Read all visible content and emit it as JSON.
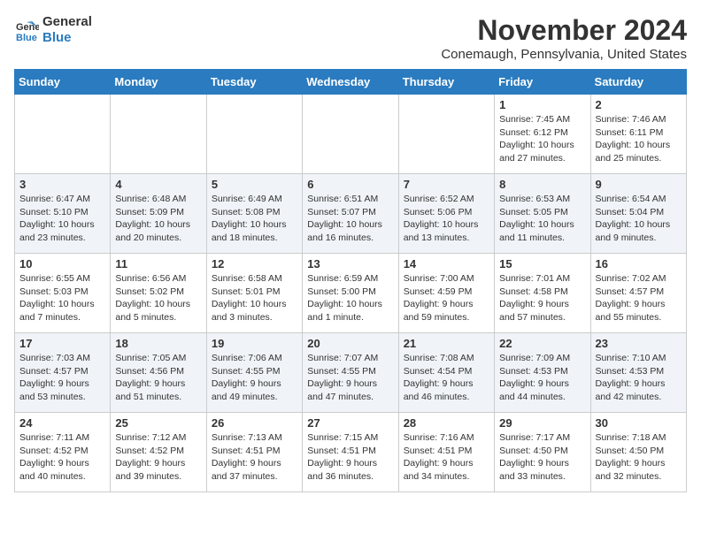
{
  "logo": {
    "text_general": "General",
    "text_blue": "Blue"
  },
  "title": "November 2024",
  "subtitle": "Conemaugh, Pennsylvania, United States",
  "days_of_week": [
    "Sunday",
    "Monday",
    "Tuesday",
    "Wednesday",
    "Thursday",
    "Friday",
    "Saturday"
  ],
  "weeks": [
    [
      {
        "day": "",
        "info": ""
      },
      {
        "day": "",
        "info": ""
      },
      {
        "day": "",
        "info": ""
      },
      {
        "day": "",
        "info": ""
      },
      {
        "day": "",
        "info": ""
      },
      {
        "day": "1",
        "info": "Sunrise: 7:45 AM\nSunset: 6:12 PM\nDaylight: 10 hours and 27 minutes."
      },
      {
        "day": "2",
        "info": "Sunrise: 7:46 AM\nSunset: 6:11 PM\nDaylight: 10 hours and 25 minutes."
      }
    ],
    [
      {
        "day": "3",
        "info": "Sunrise: 6:47 AM\nSunset: 5:10 PM\nDaylight: 10 hours and 23 minutes."
      },
      {
        "day": "4",
        "info": "Sunrise: 6:48 AM\nSunset: 5:09 PM\nDaylight: 10 hours and 20 minutes."
      },
      {
        "day": "5",
        "info": "Sunrise: 6:49 AM\nSunset: 5:08 PM\nDaylight: 10 hours and 18 minutes."
      },
      {
        "day": "6",
        "info": "Sunrise: 6:51 AM\nSunset: 5:07 PM\nDaylight: 10 hours and 16 minutes."
      },
      {
        "day": "7",
        "info": "Sunrise: 6:52 AM\nSunset: 5:06 PM\nDaylight: 10 hours and 13 minutes."
      },
      {
        "day": "8",
        "info": "Sunrise: 6:53 AM\nSunset: 5:05 PM\nDaylight: 10 hours and 11 minutes."
      },
      {
        "day": "9",
        "info": "Sunrise: 6:54 AM\nSunset: 5:04 PM\nDaylight: 10 hours and 9 minutes."
      }
    ],
    [
      {
        "day": "10",
        "info": "Sunrise: 6:55 AM\nSunset: 5:03 PM\nDaylight: 10 hours and 7 minutes."
      },
      {
        "day": "11",
        "info": "Sunrise: 6:56 AM\nSunset: 5:02 PM\nDaylight: 10 hours and 5 minutes."
      },
      {
        "day": "12",
        "info": "Sunrise: 6:58 AM\nSunset: 5:01 PM\nDaylight: 10 hours and 3 minutes."
      },
      {
        "day": "13",
        "info": "Sunrise: 6:59 AM\nSunset: 5:00 PM\nDaylight: 10 hours and 1 minute."
      },
      {
        "day": "14",
        "info": "Sunrise: 7:00 AM\nSunset: 4:59 PM\nDaylight: 9 hours and 59 minutes."
      },
      {
        "day": "15",
        "info": "Sunrise: 7:01 AM\nSunset: 4:58 PM\nDaylight: 9 hours and 57 minutes."
      },
      {
        "day": "16",
        "info": "Sunrise: 7:02 AM\nSunset: 4:57 PM\nDaylight: 9 hours and 55 minutes."
      }
    ],
    [
      {
        "day": "17",
        "info": "Sunrise: 7:03 AM\nSunset: 4:57 PM\nDaylight: 9 hours and 53 minutes."
      },
      {
        "day": "18",
        "info": "Sunrise: 7:05 AM\nSunset: 4:56 PM\nDaylight: 9 hours and 51 minutes."
      },
      {
        "day": "19",
        "info": "Sunrise: 7:06 AM\nSunset: 4:55 PM\nDaylight: 9 hours and 49 minutes."
      },
      {
        "day": "20",
        "info": "Sunrise: 7:07 AM\nSunset: 4:55 PM\nDaylight: 9 hours and 47 minutes."
      },
      {
        "day": "21",
        "info": "Sunrise: 7:08 AM\nSunset: 4:54 PM\nDaylight: 9 hours and 46 minutes."
      },
      {
        "day": "22",
        "info": "Sunrise: 7:09 AM\nSunset: 4:53 PM\nDaylight: 9 hours and 44 minutes."
      },
      {
        "day": "23",
        "info": "Sunrise: 7:10 AM\nSunset: 4:53 PM\nDaylight: 9 hours and 42 minutes."
      }
    ],
    [
      {
        "day": "24",
        "info": "Sunrise: 7:11 AM\nSunset: 4:52 PM\nDaylight: 9 hours and 40 minutes."
      },
      {
        "day": "25",
        "info": "Sunrise: 7:12 AM\nSunset: 4:52 PM\nDaylight: 9 hours and 39 minutes."
      },
      {
        "day": "26",
        "info": "Sunrise: 7:13 AM\nSunset: 4:51 PM\nDaylight: 9 hours and 37 minutes."
      },
      {
        "day": "27",
        "info": "Sunrise: 7:15 AM\nSunset: 4:51 PM\nDaylight: 9 hours and 36 minutes."
      },
      {
        "day": "28",
        "info": "Sunrise: 7:16 AM\nSunset: 4:51 PM\nDaylight: 9 hours and 34 minutes."
      },
      {
        "day": "29",
        "info": "Sunrise: 7:17 AM\nSunset: 4:50 PM\nDaylight: 9 hours and 33 minutes."
      },
      {
        "day": "30",
        "info": "Sunrise: 7:18 AM\nSunset: 4:50 PM\nDaylight: 9 hours and 32 minutes."
      }
    ]
  ]
}
